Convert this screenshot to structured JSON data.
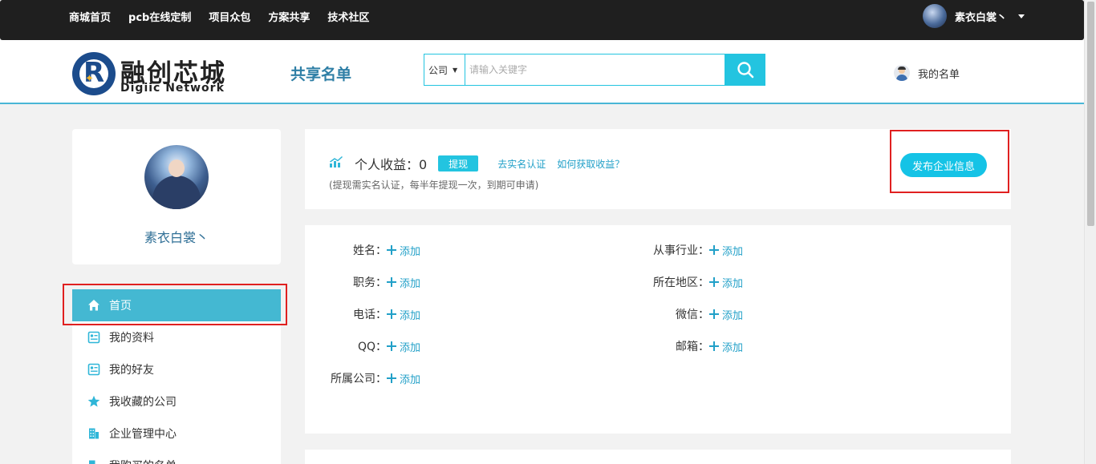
{
  "topnav": [
    "商城首页",
    "pcb在线定制",
    "项目众包",
    "方案共享",
    "技术社区"
  ],
  "top_user": {
    "name": "素衣白裳丶"
  },
  "logo": {
    "cn": "融创芯城",
    "en": "Digiic Network"
  },
  "header": {
    "share_title": "共享名单",
    "my_list": "我的名单"
  },
  "search": {
    "category": "公司",
    "placeholder": "请输入关键字"
  },
  "profile": {
    "name": "素衣白裳丶"
  },
  "menu": [
    {
      "label": "首页",
      "icon": "home-icon",
      "active": true
    },
    {
      "label": "我的资料",
      "icon": "profile-card-icon"
    },
    {
      "label": "我的好友",
      "icon": "profile-card-icon"
    },
    {
      "label": "我收藏的公司",
      "icon": "star-icon"
    },
    {
      "label": "企业管理中心",
      "icon": "building-icon"
    },
    {
      "label": "我购买的名单",
      "icon": "building-icon"
    }
  ],
  "income": {
    "label": "个人收益：0",
    "withdraw": "提现",
    "verify_link": "去实名认证",
    "how_link": "如何获取收益？",
    "note": "(提现需实名认证，每半年提现一次，到期可申请)",
    "publish": "发布企业信息"
  },
  "fields": {
    "add_label": "添加",
    "left": [
      "姓名：",
      "职务：",
      "电话：",
      "QQ：",
      "所属公司："
    ],
    "right": [
      "从事行业：",
      "所在地区：",
      "微信：",
      "邮箱："
    ]
  },
  "colors": {
    "accent": "#23c4e0",
    "menu_active": "#44b8d2",
    "link": "#22a0c8",
    "highlight_box": "#e02020"
  }
}
